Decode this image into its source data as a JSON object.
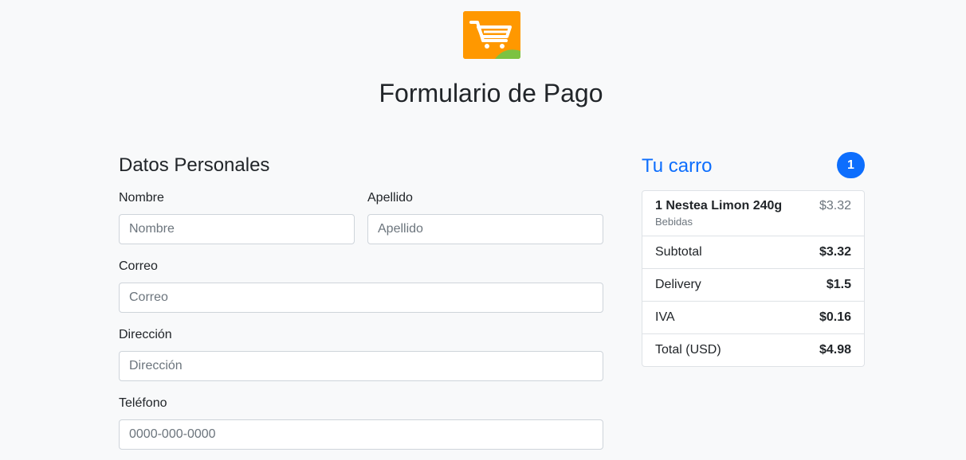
{
  "header": {
    "title": "Formulario de Pago",
    "logo_icon": "shopping-cart-icon",
    "logo_color": "#f39c12"
  },
  "form": {
    "section_title": "Datos Personales",
    "fields": {
      "nombre": {
        "label": "Nombre",
        "placeholder": "Nombre",
        "value": ""
      },
      "apellido": {
        "label": "Apellido",
        "placeholder": "Apellido",
        "value": ""
      },
      "correo": {
        "label": "Correo",
        "placeholder": "Correo",
        "value": ""
      },
      "direccion": {
        "label": "Dirección",
        "placeholder": "Dirección",
        "value": ""
      },
      "telefono": {
        "label": "Teléfono",
        "placeholder": "0000-000-0000",
        "value": ""
      }
    }
  },
  "cart": {
    "title": "Tu carro",
    "count": "1",
    "accent": "#0d6efd",
    "items": [
      {
        "name": "1 Nestea Limon 240g",
        "category": "Bebidas",
        "price": "$3.32"
      }
    ],
    "summary": [
      {
        "label": "Subtotal",
        "value": "$3.32"
      },
      {
        "label": "Delivery",
        "value": "$1.5"
      },
      {
        "label": "IVA",
        "value": "$0.16"
      },
      {
        "label": "Total (USD)",
        "value": "$4.98"
      }
    ]
  }
}
